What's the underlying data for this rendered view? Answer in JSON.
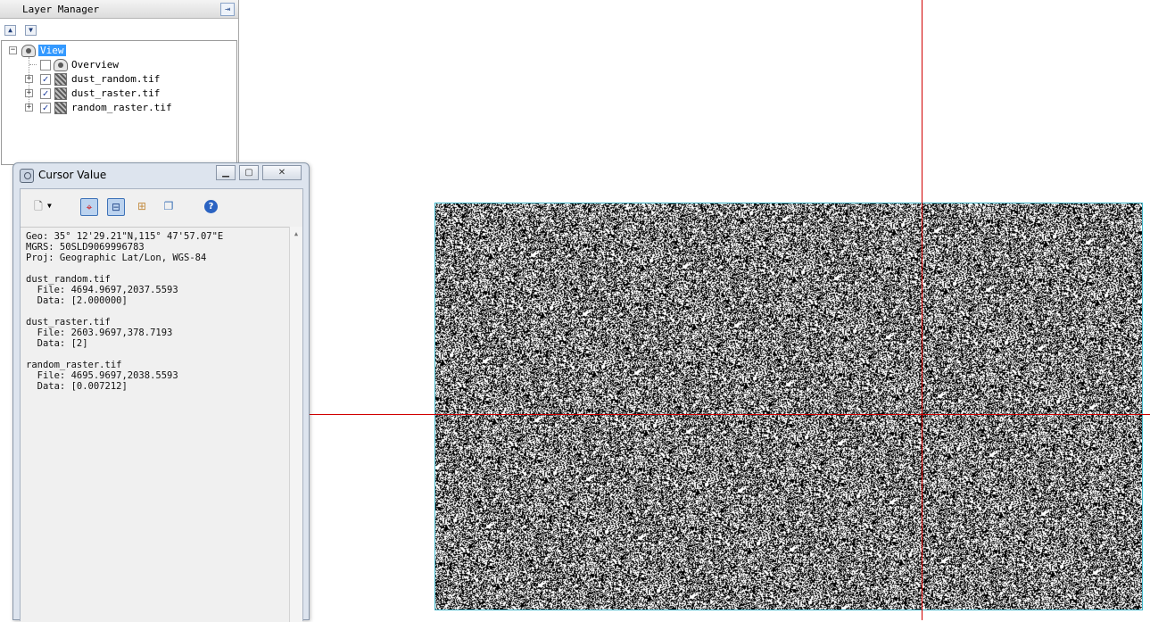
{
  "layer_manager": {
    "title": "Layer Manager",
    "tree": {
      "root_label": "View",
      "items": [
        {
          "label": "Overview",
          "checked": false,
          "icon": "overview-eye-icon"
        },
        {
          "label": "dust_random.tif",
          "checked": true,
          "icon": "raster-icon"
        },
        {
          "label": "dust_raster.tif",
          "checked": true,
          "icon": "raster-icon"
        },
        {
          "label": "random_raster.tif",
          "checked": true,
          "icon": "raster-icon"
        }
      ]
    }
  },
  "cursor_value": {
    "title": "Cursor Value",
    "lines": [
      "Geo: 35° 12'29.21\"N,115° 47'57.07\"E",
      "MGRS: 50SLD9069996783",
      "Proj: Geographic Lat/Lon, WGS-84",
      "",
      "dust_random.tif",
      "  File: 4694.9697,2037.5593",
      "  Data: [2.000000]",
      "",
      "dust_raster.tif",
      "  File: 2603.9697,378.7193",
      "  Data: [2]",
      "",
      "random_raster.tif",
      "  File: 4695.9697,2038.5593",
      "  Data: [0.007212]"
    ]
  },
  "colors": {
    "crosshair": "#d10000",
    "raster_border": "#41b6c9",
    "selection": "#3399ff"
  }
}
